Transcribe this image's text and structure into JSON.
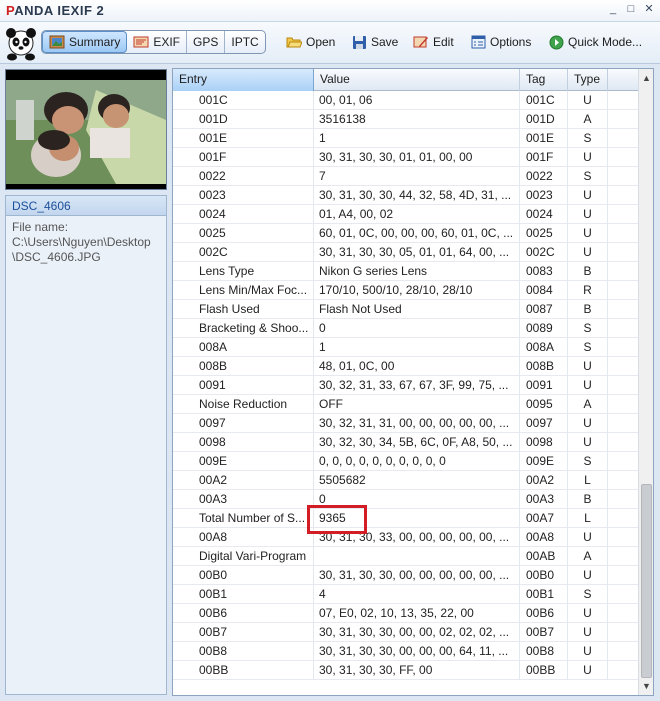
{
  "window": {
    "title_prefix": "P",
    "title_rest": "ANDA IEXIF 2",
    "controls": [
      "_",
      "□",
      "✕"
    ]
  },
  "toolbar": {
    "tabs": [
      {
        "label": "Summary",
        "icon": "summary-icon",
        "active": true
      },
      {
        "label": "EXIF",
        "icon": "exif-icon",
        "active": false
      },
      {
        "label": "GPS",
        "icon": "",
        "active": false
      },
      {
        "label": "IPTC",
        "icon": "",
        "active": false
      }
    ],
    "open_label": "Open",
    "save_label": "Save",
    "edit_label": "Edit",
    "options_label": "Options",
    "quick_mode_label": "Quick Mode..."
  },
  "file_info": {
    "name": "DSC_4606",
    "file_name_label": "File name:",
    "path": "C:\\Users\\Nguyen\\Desktop\\DSC_4606.JPG"
  },
  "table": {
    "headers": [
      "Entry",
      "Value",
      "Tag",
      "Type"
    ],
    "rows": [
      [
        "001C",
        "00, 01, 06",
        "001C",
        "U"
      ],
      [
        "001D",
        "3516138",
        "001D",
        "A"
      ],
      [
        "001E",
        "1",
        "001E",
        "S"
      ],
      [
        "001F",
        "30, 31, 30, 30, 01, 01, 00, 00",
        "001F",
        "U"
      ],
      [
        "0022",
        "7",
        "0022",
        "S"
      ],
      [
        "0023",
        "30, 31, 30, 30, 44, 32, 58, 4D, 31, ...",
        "0023",
        "U"
      ],
      [
        "0024",
        "01, A4, 00, 02",
        "0024",
        "U"
      ],
      [
        "0025",
        "60, 01, 0C, 00, 00, 00, 60, 01, 0C, ...",
        "0025",
        "U"
      ],
      [
        "002C",
        "30, 31, 30, 30, 05, 01, 01, 64, 00, ...",
        "002C",
        "U"
      ],
      [
        "Lens Type",
        "Nikon G series Lens",
        "0083",
        "B"
      ],
      [
        "Lens Min/Max Foc...",
        "170/10, 500/10, 28/10, 28/10",
        "0084",
        "R"
      ],
      [
        "Flash Used",
        "Flash Not Used",
        "0087",
        "B"
      ],
      [
        "Bracketing & Shoo...",
        "0",
        "0089",
        "S"
      ],
      [
        "008A",
        "1",
        "008A",
        "S"
      ],
      [
        "008B",
        "48, 01, 0C, 00",
        "008B",
        "U"
      ],
      [
        "0091",
        "30, 32, 31, 33, 67, 67, 3F, 99, 75, ...",
        "0091",
        "U"
      ],
      [
        "Noise Reduction",
        "OFF",
        "0095",
        "A"
      ],
      [
        "0097",
        "30, 32, 31, 31, 00, 00, 00, 00, 00, ...",
        "0097",
        "U"
      ],
      [
        "0098",
        "30, 32, 30, 34, 5B, 6C, 0F, A8, 50, ...",
        "0098",
        "U"
      ],
      [
        "009E",
        "0, 0, 0, 0, 0, 0, 0, 0, 0, 0",
        "009E",
        "S"
      ],
      [
        "00A2",
        "5505682",
        "00A2",
        "L"
      ],
      [
        "00A3",
        "0",
        "00A3",
        "B"
      ],
      [
        "Total Number of S...",
        "9365",
        "00A7",
        "L"
      ],
      [
        "00A8",
        "30, 31, 30, 33, 00, 00, 00, 00, 00, ...",
        "00A8",
        "U"
      ],
      [
        "Digital Vari-Program",
        "",
        "00AB",
        "A"
      ],
      [
        "00B0",
        "30, 31, 30, 30, 00, 00, 00, 00, 00, ...",
        "00B0",
        "U"
      ],
      [
        "00B1",
        "4",
        "00B1",
        "S"
      ],
      [
        "00B6",
        "07, E0, 02, 10, 13, 35, 22, 00",
        "00B6",
        "U"
      ],
      [
        "00B7",
        "30, 31, 30, 30, 00, 00, 02, 02, 02, ...",
        "00B7",
        "U"
      ],
      [
        "00B8",
        "30, 31, 30, 30, 00, 00, 00, 64, 11, ...",
        "00B8",
        "U"
      ],
      [
        "00BB",
        "30, 31, 30, 30, FF, 00",
        "00BB",
        "U"
      ]
    ]
  },
  "scroll": {
    "up": "▲",
    "down": "▼"
  }
}
